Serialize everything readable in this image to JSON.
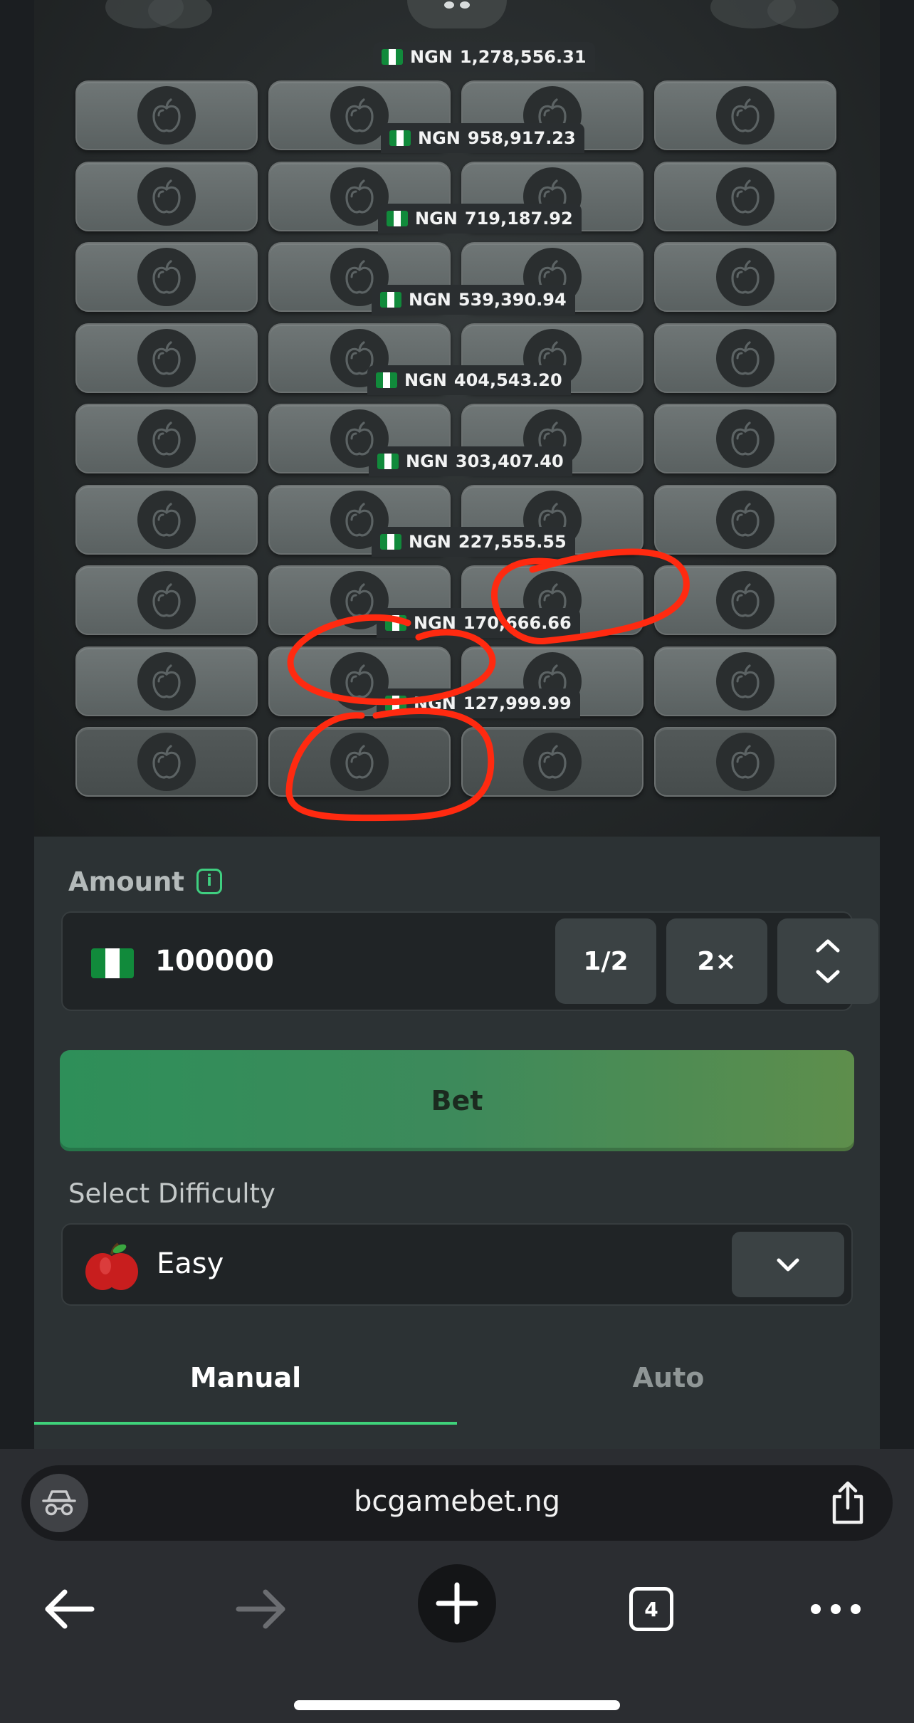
{
  "payouts": [
    {
      "currency": "NGN",
      "amount": "1,278,556.31"
    },
    {
      "currency": "NGN",
      "amount": "958,917.23"
    },
    {
      "currency": "NGN",
      "amount": "719,187.92"
    },
    {
      "currency": "NGN",
      "amount": "539,390.94"
    },
    {
      "currency": "NGN",
      "amount": "404,543.20"
    },
    {
      "currency": "NGN",
      "amount": "303,407.40"
    },
    {
      "currency": "NGN",
      "amount": "227,555.55"
    },
    {
      "currency": "NGN",
      "amount": "170,666.66"
    },
    {
      "currency": "NGN",
      "amount": "127,999.99"
    }
  ],
  "board": {
    "rows": 9,
    "columns": 4,
    "tile_icon": "apple-icon"
  },
  "amount": {
    "label": "Amount",
    "info_icon": "info-icon",
    "value": "100000",
    "half_label": "1/2",
    "double_label": "2×",
    "stepper_icon": "chevron-up-down-icon",
    "currency_flag": "nigeria-flag-icon"
  },
  "bet": {
    "label": "Bet"
  },
  "difficulty": {
    "label": "Select Difficulty",
    "value": "Easy",
    "icon": "red-apple-icon",
    "dropdown_icon": "chevron-down-icon"
  },
  "tabs": [
    {
      "label": "Manual",
      "active": true
    },
    {
      "label": "Auto",
      "active": false
    }
  ],
  "browser": {
    "url": "bcgamebet.ng",
    "tab_count": "4"
  },
  "colors": {
    "accent_green": "#3fd27a",
    "bet_green": "#2e8f59",
    "annotation_red": "#ff2a10",
    "panel": "#2c3234"
  }
}
